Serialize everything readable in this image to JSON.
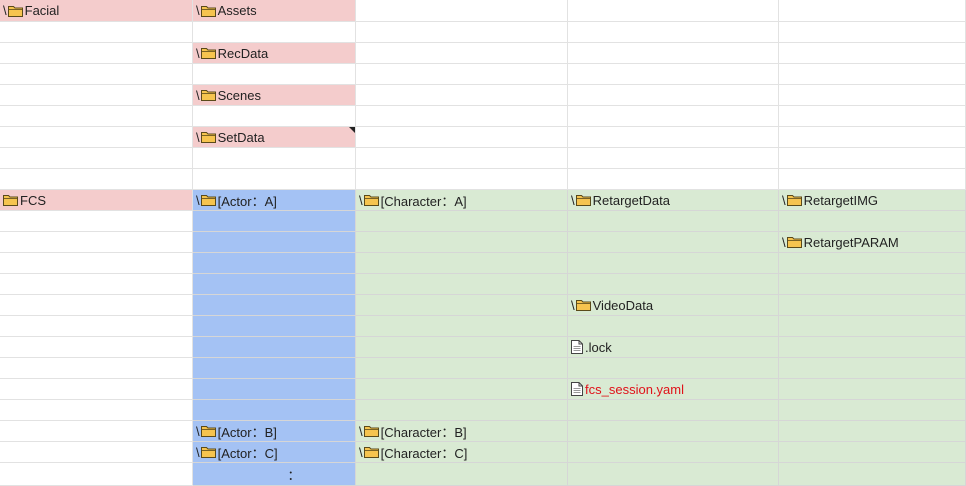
{
  "sheet": {
    "col_a": {
      "facial": "Facial",
      "fcs": "FCS"
    },
    "col_b": {
      "assets": "Assets",
      "recdata": "RecData",
      "scenes": "Scenes",
      "setdata": "SetData",
      "actor_a": "[Actor：A]",
      "actor_b": "[Actor：B]",
      "actor_c": "[Actor：C]",
      "ellipsis": "："
    },
    "col_c": {
      "char_a": "[Character：A]",
      "char_b": "[Character：B]",
      "char_c": "[Character：C]"
    },
    "col_d": {
      "retarget_data": "RetargetData",
      "video_data": "VideoData",
      "lock_file": ".lock",
      "session_file": "fcs_session.yaml"
    },
    "col_e": {
      "retarget_img": "RetargetIMG",
      "retarget_param": "RetargetPARAM"
    },
    "path_separator": "\\"
  },
  "colors": {
    "pink": "#f4cccc",
    "blue": "#a4c2f4",
    "green": "#d9ead3",
    "folder": "#f6c44f",
    "red_text": "#e0121a"
  },
  "icons": {
    "folder": "folder-icon",
    "file": "file-icon"
  }
}
